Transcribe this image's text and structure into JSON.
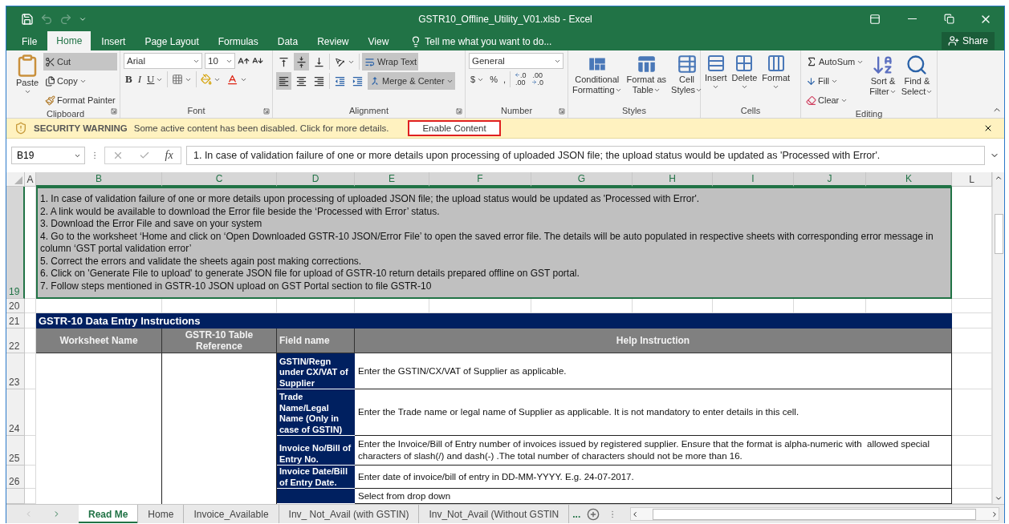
{
  "window": {
    "title": "GSTR10_Offline_Utility_V01.xlsb - Excel"
  },
  "ribbon_tabs": [
    {
      "label": "File",
      "selected": false
    },
    {
      "label": "Home",
      "selected": true
    },
    {
      "label": "Insert",
      "selected": false
    },
    {
      "label": "Page Layout",
      "selected": false
    },
    {
      "label": "Formulas",
      "selected": false
    },
    {
      "label": "Data",
      "selected": false
    },
    {
      "label": "Review",
      "selected": false
    },
    {
      "label": "View",
      "selected": false
    }
  ],
  "tell_me": "Tell me what you want to do...",
  "share": "Share",
  "clipboard": {
    "label": "Clipboard",
    "paste": "Paste",
    "cut": {
      "label": "Cut",
      "on": true
    },
    "copy": "Copy",
    "format_painter": "Format Painter"
  },
  "font": {
    "label": "Font",
    "name": "Arial",
    "size": "10",
    "bold": "B",
    "italic": "I",
    "underline": "U"
  },
  "alignment": {
    "label": "Alignment",
    "vertical": [
      {
        "on": false
      },
      {
        "on": true
      },
      {
        "on": false
      }
    ],
    "horizontal": [
      {
        "on": true
      },
      {
        "on": false
      },
      {
        "on": false
      }
    ],
    "wrap_text": {
      "label": "Wrap Text",
      "on": true
    },
    "merge": {
      "label": "Merge & Center",
      "on": true
    }
  },
  "number": {
    "label": "Number",
    "format": "General",
    "currency": "$",
    "percent": "%",
    "comma": ",",
    "increase_decimal": [
      ".0",
      ".00"
    ],
    "decrease_decimal": [
      ".00",
      ".0"
    ]
  },
  "styles": {
    "label": "Styles",
    "buttons": [
      {
        "lines": [
          "Conditional",
          "Formatting"
        ]
      },
      {
        "lines": [
          "Format as",
          "Table"
        ]
      },
      {
        "lines": [
          "Cell",
          "Styles"
        ]
      }
    ]
  },
  "cells": {
    "label": "Cells",
    "buttons": [
      "Insert",
      "Delete",
      "Format"
    ]
  },
  "editing": {
    "label": "Editing",
    "autosum": "AutoSum",
    "fill": "Fill",
    "clear": "Clear",
    "sort": [
      "Sort &",
      "Filter"
    ],
    "find": [
      "Find &",
      "Select"
    ]
  },
  "security_bar": {
    "title": "SECURITY WARNING",
    "message": "Some active content has been disabled. Click for more details.",
    "button": "Enable Content"
  },
  "formula_bar": {
    "name_box": "B19",
    "function_label": "fx",
    "value": "1. In case of validation failure of one or more details upon processing of uploaded JSON file; the upload status would be updated as 'Processed with Error'."
  },
  "sheet": {
    "columns": [
      {
        "label": "A",
        "selected": false
      },
      {
        "label": "B",
        "selected": true
      },
      {
        "label": "C",
        "selected": true
      },
      {
        "label": "D",
        "selected": true
      },
      {
        "label": "E",
        "selected": true
      },
      {
        "label": "F",
        "selected": true
      },
      {
        "label": "G",
        "selected": true
      },
      {
        "label": "H",
        "selected": true
      },
      {
        "label": "I",
        "selected": true
      },
      {
        "label": "J",
        "selected": true
      },
      {
        "label": "K",
        "selected": true
      },
      {
        "label": "L",
        "selected": false
      }
    ],
    "rows": [
      {
        "label": "19",
        "selected": true
      },
      {
        "label": "20",
        "selected": false
      },
      {
        "label": "21",
        "selected": false
      },
      {
        "label": "22",
        "selected": false
      },
      {
        "label": "23",
        "selected": false
      },
      {
        "label": "24",
        "selected": false
      },
      {
        "label": "25",
        "selected": false
      },
      {
        "label": "26",
        "selected": false
      }
    ],
    "instructions": {
      "selected": true,
      "lines": [
        "1. In case of validation failure of one or more details upon processing of uploaded JSON file; the upload status would be updated as 'Processed with Error'.",
        "2. A link would be available to download the Error file beside the ‘Processed with Error’ status.",
        "3. Download the Error File and save on your system",
        "4. Go to the worksheet ‘Home and click on ‘Open Downloaded GSTR-10 JSON/Error File’ to open the saved error file. The details will be auto populated in respective sheets with corresponding error message in column ‘GST portal validation error’",
        "5. Correct the errors and validate the sheets again post making corrections.",
        "6. Click on 'Generate File to upload' to generate JSON file for upload of GSTR-10 return details prepared offline on GST portal.",
        "7. Follow steps mentioned in GSTR-10 JSON upload on GST Portal section to file GSTR-10"
      ]
    },
    "table": {
      "title": "GSTR-10 Data Entry Instructions",
      "headers": [
        "Worksheet Name",
        "GSTR-10 Table Reference",
        "Field name",
        "Help Instruction"
      ],
      "rows": [
        {
          "field": "GSTIN/Regn under CX/VAT of Supplier",
          "help": "Enter the GSTIN/CX/VAT of Supplier as applicable."
        },
        {
          "field": "Trade Name/Legal Name (Only in case of GSTIN)",
          "help": "Enter the Trade name or legal name of Supplier as applicable. It is not mandatory to enter details in this cell."
        },
        {
          "field": "Invoice No/Bill of Entry No.",
          "help": "Enter the Invoice/Bill of Entry number of invoices issued by registered supplier. Ensure that the format is alpha-numeric with  allowed special characters of slash(/) and dash(-) .The total number of characters should not be more than 16."
        },
        {
          "field": "Invoice Date/Bill of Entry Date.",
          "help": "Enter date of invoice/bill of entry in DD-MM-YYYY. E.g. 24-07-2017."
        },
        {
          "help": "Select from drop down"
        }
      ]
    }
  },
  "sheet_tabs": [
    {
      "label": "Read Me",
      "selected": true
    },
    {
      "label": "Home",
      "selected": false
    },
    {
      "label": "Invoice_Available",
      "selected": false
    },
    {
      "label": "Inv_ Not_Avail (with GSTIN)",
      "selected": false
    },
    {
      "label": "Inv_Not_Avail (Without GSTIN",
      "selected": false
    }
  ],
  "more_tabs": "..."
}
